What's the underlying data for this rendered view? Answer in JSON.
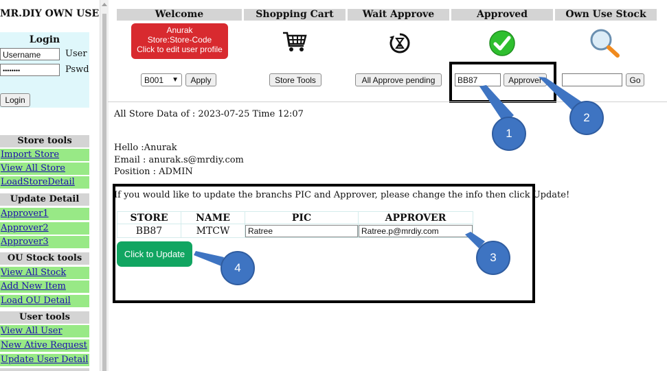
{
  "app": {
    "title": "MR.DIY OWN USE"
  },
  "login": {
    "heading": "Login",
    "username_placeholder": "Username",
    "username_label": "User",
    "password_value": "••••••••",
    "password_label": "Pswd",
    "login_button": "Login"
  },
  "sidebar": {
    "store_tools": {
      "heading": "Store tools",
      "items": [
        "Import Store",
        "View All Store",
        "LoadStoreDetail"
      ]
    },
    "update_detail": {
      "heading": "Update Detail",
      "items": [
        "Approver1",
        "Approver2",
        "Approver3"
      ]
    },
    "ou_stock_tools": {
      "heading": "OU Stock tools",
      "items": [
        "View All Stock",
        "Add New Item",
        "Load OU Detail"
      ]
    },
    "user_tools": {
      "heading": "User tools",
      "items": [
        "View All User",
        "New Ative Request",
        "Update User Detail"
      ]
    }
  },
  "header": {
    "columns": [
      "Welcome",
      "Shopping Cart",
      "Wait Approve",
      "Approved",
      "Own Use Stock"
    ],
    "profile_badge": {
      "name": "Anurak",
      "store": "Store:Store-Code",
      "hint": "Click to edit user profile"
    },
    "icons": [
      "cart-icon",
      "hourglass-icon",
      "checkmark-icon",
      "magnifier-icon"
    ]
  },
  "controls": {
    "store_select_value": "B001",
    "apply_button": "Apply",
    "store_tools_button": "Store Tools",
    "approve_pending_button": "All Approve pending",
    "approver_input_value": "BB87",
    "approver_button": "Approver",
    "stock_search_value": "",
    "go_button": "Go"
  },
  "main": {
    "data_line": "All Store Data of : 2023-07-25 Time 12:07",
    "hello": "Hello :Anurak",
    "email": "Email : anurak.s@mrdiy.com",
    "position": "Position : ADMIN",
    "instruction": "If you would like to update the branchs PIC and Approver, please change the info then click Update!",
    "table": {
      "headers": [
        "STORE",
        "NAME",
        "PIC",
        "APPROVER"
      ],
      "row": {
        "store": "BB87",
        "name": "MTCW",
        "pic": "Ratree",
        "approver": "Ratree.p@mrdiy.com"
      }
    },
    "update_button": "Click to Update"
  },
  "callouts": [
    "1",
    "2",
    "3",
    "4"
  ],
  "colors": {
    "badge": "#d82a2f",
    "nav_green": "#98e986",
    "login_bg": "#dff7fb",
    "update_btn": "#11a561",
    "callout": "#3e74c2"
  }
}
